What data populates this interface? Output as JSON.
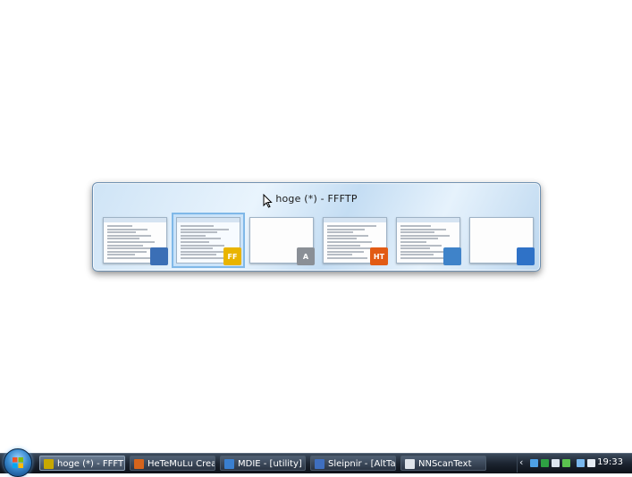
{
  "switcher": {
    "title": "hoge (*) - FFFTP",
    "thumbnails": [
      {
        "name": "thumb-window-1",
        "icon": "network-globe-icon",
        "icon_color": "#3b6fb6",
        "icon_text": ""
      },
      {
        "name": "thumb-ffftp",
        "icon": "ffftp-icon",
        "icon_color": "#e9b400",
        "icon_text": "FF",
        "selected": true
      },
      {
        "name": "thumb-nnscantext",
        "icon": "scanner-text-icon",
        "icon_color": "#8a8f96",
        "icon_text": "A"
      },
      {
        "name": "thumb-hetemulu",
        "icon": "hetemulu-icon",
        "icon_color": "#e25b14",
        "icon_text": "HT"
      },
      {
        "name": "thumb-mdie",
        "icon": "mdie-windows-icon",
        "icon_color": "#3f83c9",
        "icon_text": ""
      },
      {
        "name": "thumb-desktop",
        "icon": "desktop-icon",
        "icon_color": "#2f72c7",
        "icon_text": ""
      }
    ]
  },
  "taskbar": {
    "tasks": [
      {
        "label": "hoge (*) - FFFTP",
        "icon": "ffftp-icon",
        "color": "#c8a800",
        "active": true
      },
      {
        "label": "HeTeMuLu Crea...",
        "icon": "hetemulu-icon",
        "color": "#d5641c",
        "active": false
      },
      {
        "label": "MDIE - [utility]",
        "icon": "mdie-icon",
        "color": "#3a7fcf",
        "active": false
      },
      {
        "label": "Sleipnir - [AltTa...",
        "icon": "sleipnir-icon",
        "color": "#3f6fbf",
        "active": false
      },
      {
        "label": "NNScanText",
        "icon": "nnscantext-icon",
        "color": "#dfe4ea",
        "active": false
      }
    ],
    "tray_icons": [
      {
        "name": "tray-network-icon",
        "color": "#4ea1e6"
      },
      {
        "name": "tray-green-icon",
        "color": "#2ea043"
      },
      {
        "name": "tray-shield-icon",
        "color": "#dce6f0"
      },
      {
        "name": "tray-update-icon",
        "color": "#5bc24f"
      },
      {
        "name": "tray-monitor-icon",
        "color": "#79b8ee"
      },
      {
        "name": "tray-volume-icon",
        "color": "#e5ecf4"
      }
    ],
    "tray_chevron": "‹",
    "clock": "19:33"
  }
}
